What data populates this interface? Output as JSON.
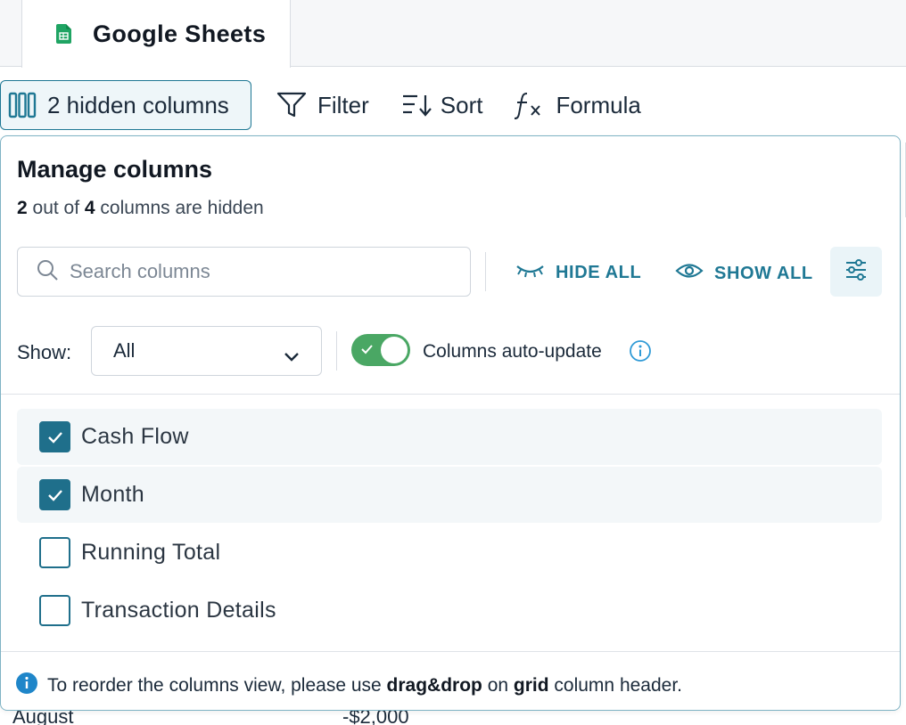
{
  "tab": {
    "title": "Google Sheets",
    "icon": "google-sheets-icon"
  },
  "toolbar": {
    "hidden_columns_label": "2 hidden columns",
    "filter_label": "Filter",
    "sort_label": "Sort",
    "formula_label": "Formula"
  },
  "background_grid": {
    "row_label": "August",
    "row_value": "-$2,000"
  },
  "panel": {
    "title": "Manage columns",
    "subtitle": {
      "hidden": "2",
      "mid": " out of ",
      "total": "4",
      "suffix": " columns are hidden"
    },
    "search_placeholder": "Search columns",
    "hide_all_label": "HIDE ALL",
    "show_all_label": "SHOW ALL",
    "show_label": "Show:",
    "show_value": "All",
    "auto_update_label": "Columns auto-update",
    "auto_update_on": true,
    "columns": [
      {
        "label": "Cash Flow",
        "checked": true
      },
      {
        "label": "Month",
        "checked": true
      },
      {
        "label": "Running Total",
        "checked": false
      },
      {
        "label": "Transaction Details",
        "checked": false
      }
    ],
    "footer": {
      "prefix": "To reorder the columns view, please use ",
      "bold1": "drag&drop",
      "mid": " on ",
      "bold2": "grid",
      "suffix": " column header."
    }
  },
  "colors": {
    "accent": "#1f7894",
    "toggle_on": "#4aa764",
    "checkbox": "#1f6f8b",
    "sheets_green": "#1fa463"
  }
}
